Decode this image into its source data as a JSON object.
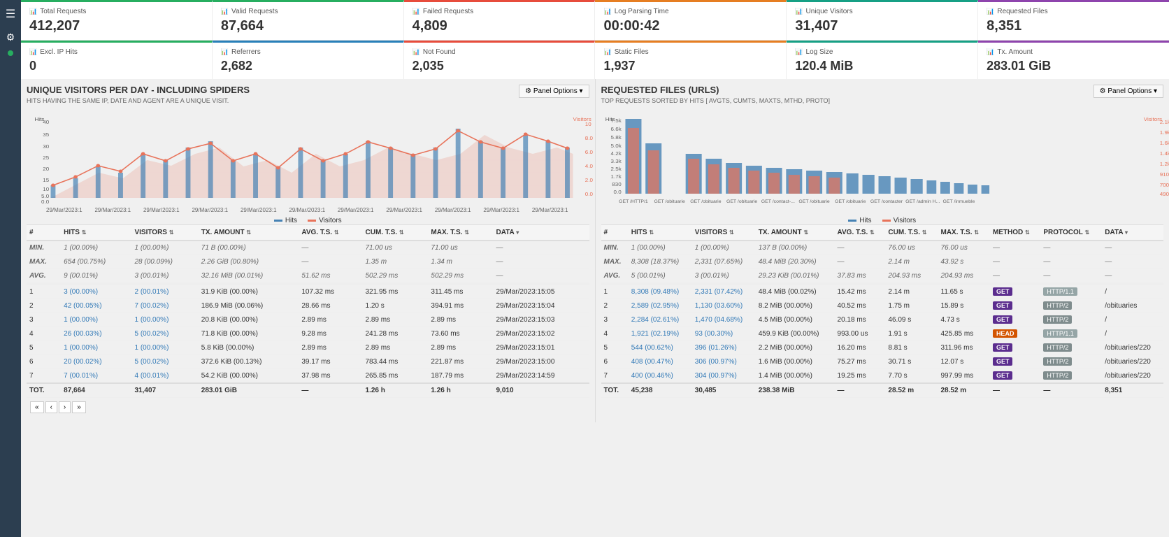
{
  "sidebar": {
    "hamburger": "☰",
    "gear": "⚙",
    "dot_color": "#27ae60"
  },
  "stats": {
    "row1": [
      {
        "label": "Total Requests",
        "value": "412,207",
        "border": "border-green"
      },
      {
        "label": "Valid Requests",
        "value": "87,664",
        "border": "border-green"
      },
      {
        "label": "Failed Requests",
        "value": "4,809",
        "border": "border-red"
      },
      {
        "label": "Log Parsing Time",
        "value": "00:00:42",
        "border": "border-orange"
      },
      {
        "label": "Unique Visitors",
        "value": "31,407",
        "border": "border-teal"
      },
      {
        "label": "Requested Files",
        "value": "8,351",
        "border": "border-purple"
      }
    ],
    "row2": [
      {
        "label": "Excl. IP Hits",
        "value": "0",
        "border": "border-green"
      },
      {
        "label": "Referrers",
        "value": "2,682",
        "border": "border-blue"
      },
      {
        "label": "Not Found",
        "value": "2,035",
        "border": "border-red"
      },
      {
        "label": "Static Files",
        "value": "1,937",
        "border": "border-orange"
      },
      {
        "label": "Log Size",
        "value": "120.4 MiB",
        "border": "border-teal"
      },
      {
        "label": "Tx. Amount",
        "value": "283.01 GiB",
        "border": "border-purple"
      }
    ]
  },
  "visitors_section": {
    "title": "UNIQUE VISITORS PER DAY - INCLUDING SPIDERS",
    "subtitle": "HITS HAVING THE SAME IP, DATE AND AGENT ARE A UNIQUE VISIT.",
    "panel_options": "⚙ Panel Options ▾"
  },
  "requested_files_section": {
    "title": "REQUESTED FILES (URLS)",
    "subtitle": "TOP REQUESTS SORTED BY HITS [ AVGTS, CUMTS, MAXTS, MTHD, PROTO]",
    "panel_options": "⚙ Panel Options ▾"
  },
  "visitors_table": {
    "headers": [
      "#",
      "HITS",
      "VISITORS",
      "TX. AMOUNT",
      "AVG. T.S.",
      "CUM. T.S.",
      "MAX. T.S.",
      "DATA"
    ],
    "min_row": [
      "MIN.",
      "1 (00.00%)",
      "1 (00.00%)",
      "71 B (00.00%)",
      "—",
      "71.00 us",
      "71.00 us",
      "—"
    ],
    "max_row": [
      "MAX.",
      "654 (00.75%)",
      "28 (00.09%)",
      "2.26 GiB (00.80%)",
      "—",
      "1.35 m",
      "1.34 m",
      "—"
    ],
    "avg_row": [
      "AVG.",
      "9 (00.01%)",
      "3 (00.01%)",
      "32.16 MiB (00.01%)",
      "51.62 ms",
      "502.29 ms",
      "502.29 ms",
      "—"
    ],
    "rows": [
      [
        "1",
        "3 (00.00%)",
        "2 (00.01%)",
        "31.9 KiB (00.00%)",
        "107.32 ms",
        "321.95 ms",
        "311.45 ms",
        "29/Mar/2023:15:05"
      ],
      [
        "2",
        "42 (00.05%)",
        "7 (00.02%)",
        "186.9 MiB (00.06%)",
        "28.66 ms",
        "1.20 s",
        "394.91 ms",
        "29/Mar/2023:15:04"
      ],
      [
        "3",
        "1 (00.00%)",
        "1 (00.00%)",
        "20.8 KiB (00.00%)",
        "2.89 ms",
        "2.89 ms",
        "2.89 ms",
        "29/Mar/2023:15:03"
      ],
      [
        "4",
        "26 (00.03%)",
        "5 (00.02%)",
        "71.8 KiB (00.00%)",
        "9.28 ms",
        "241.28 ms",
        "73.60 ms",
        "29/Mar/2023:15:02"
      ],
      [
        "5",
        "1 (00.00%)",
        "1 (00.00%)",
        "5.8 KiB (00.00%)",
        "2.89 ms",
        "2.89 ms",
        "2.89 ms",
        "29/Mar/2023:15:01"
      ],
      [
        "6",
        "20 (00.02%)",
        "5 (00.02%)",
        "372.6 KiB (00.13%)",
        "39.17 ms",
        "783.44 ms",
        "221.87 ms",
        "29/Mar/2023:15:00"
      ],
      [
        "7",
        "7 (00.01%)",
        "4 (00.01%)",
        "54.2 KiB (00.00%)",
        "37.98 ms",
        "265.85 ms",
        "187.79 ms",
        "29/Mar/2023:14:59"
      ]
    ],
    "total_row": [
      "TOT.",
      "87,664",
      "31,407",
      "283.01 GiB",
      "—",
      "1.26 h",
      "1.26 h",
      "9,010"
    ]
  },
  "files_table": {
    "headers": [
      "#",
      "HITS",
      "VISITORS",
      "TX. AMOUNT",
      "AVG. T.S.",
      "CUM. T.S.",
      "MAX. T.S.",
      "METHOD",
      "PROTOCOL",
      "DATA"
    ],
    "min_row": [
      "MIN.",
      "1 (00.00%)",
      "1 (00.00%)",
      "137 B (00.00%)",
      "—",
      "76.00 us",
      "76.00 us",
      "—",
      "—",
      "—"
    ],
    "max_row": [
      "MAX.",
      "8,308 (18.37%)",
      "2,331 (07.65%)",
      "48.4 MiB (20.30%)",
      "—",
      "2.14 m",
      "43.92 s",
      "—",
      "—",
      "—"
    ],
    "avg_row": [
      "AVG.",
      "5 (00.01%)",
      "3 (00.01%)",
      "29.23 KiB (00.01%)",
      "37.83 ms",
      "204.93 ms",
      "204.93 ms",
      "—",
      "—",
      "—"
    ],
    "rows": [
      [
        "1",
        "8,308 (09.48%)",
        "2,331 (07.42%)",
        "48.4 MiB (00.02%)",
        "15.42 ms",
        "2.14 m",
        "11.65 s",
        "GET",
        "HTTP/1.1",
        "/"
      ],
      [
        "2",
        "2,589 (02.95%)",
        "1,130 (03.60%)",
        "8.2 MiB (00.00%)",
        "40.52 ms",
        "1.75 m",
        "15.89 s",
        "GET",
        "HTTP/2",
        "/obituaries"
      ],
      [
        "3",
        "2,284 (02.61%)",
        "1,470 (04.68%)",
        "4.5 MiB (00.00%)",
        "20.18 ms",
        "46.09 s",
        "4.73 s",
        "GET",
        "HTTP/2",
        "/"
      ],
      [
        "4",
        "1,921 (02.19%)",
        "93 (00.30%)",
        "459.9 KiB (00.00%)",
        "993.00 us",
        "1.91 s",
        "425.85 ms",
        "HEAD",
        "HTTP/1.1",
        "/"
      ],
      [
        "5",
        "544 (00.62%)",
        "396 (01.26%)",
        "2.2 MiB (00.00%)",
        "16.20 ms",
        "8.81 s",
        "311.96 ms",
        "GET",
        "HTTP/2",
        "/obituaries/220"
      ],
      [
        "6",
        "408 (00.47%)",
        "306 (00.97%)",
        "1.6 MiB (00.00%)",
        "75.27 ms",
        "30.71 s",
        "12.07 s",
        "GET",
        "HTTP/2",
        "/obituaries/220"
      ],
      [
        "7",
        "400 (00.46%)",
        "304 (00.97%)",
        "1.4 MiB (00.00%)",
        "19.25 ms",
        "7.70 s",
        "997.99 ms",
        "GET",
        "HTTP/2",
        "/obituaries/220"
      ]
    ],
    "total_row": [
      "TOT.",
      "45,238",
      "30,485",
      "238.38 MiB",
      "—",
      "28.52 m",
      "28.52 m",
      "—",
      "—",
      "8,351"
    ]
  },
  "chart_legend": {
    "hits_color": "#4682b4",
    "visitors_color": "#e8735a",
    "hits_label": "Hits",
    "visitors_label": "Visitors"
  },
  "pagination": {
    "first": "«",
    "prev": "‹",
    "next": "›",
    "last": "»"
  }
}
